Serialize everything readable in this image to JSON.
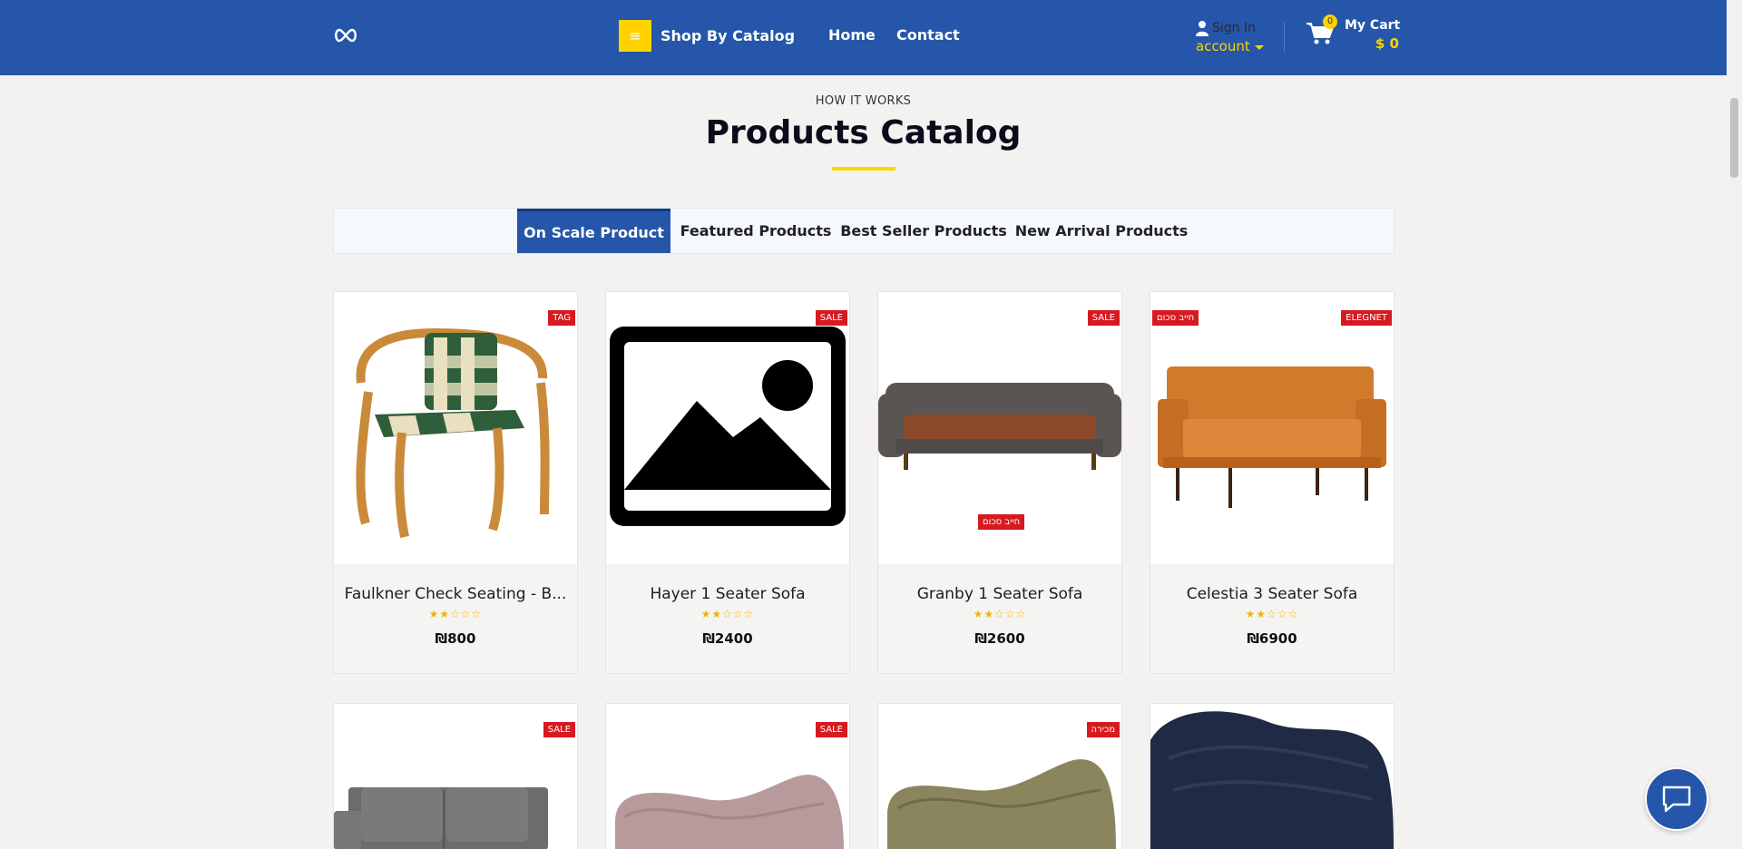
{
  "header": {
    "logo_icon": "infinity-logo-icon",
    "catalog_button_label": "Shop By Catalog",
    "nav": [
      {
        "label": "Home"
      },
      {
        "label": "Contact"
      }
    ],
    "signin": {
      "label": "Sign In",
      "account_label": "account"
    },
    "cart": {
      "label": "My Cart",
      "amount": "$ 0",
      "count": "0"
    }
  },
  "section": {
    "eyebrow": "HOW IT WORKS",
    "title": "Products Catalog"
  },
  "tabs": [
    {
      "label": "On Scale Product",
      "active": true
    },
    {
      "label": "Featured Products",
      "active": false
    },
    {
      "label": "Best Seller Products",
      "active": false
    },
    {
      "label": "New Arrival Products",
      "active": false
    }
  ],
  "products": [
    {
      "name": "Faulkner Check Seating - B...",
      "price": "₪800",
      "rating": 2,
      "badges": [
        "TAG"
      ],
      "image": "rattan-chair"
    },
    {
      "name": "Hayer 1 Seater Sofa",
      "price": "₪2400",
      "rating": 2,
      "badges": [
        "SALE"
      ],
      "image": "placeholder"
    },
    {
      "name": "Granby 1 Seater Sofa",
      "price": "₪2600",
      "rating": 2,
      "badges": [
        "SALE",
        "חייב סכום"
      ],
      "image": "chesterfield-sofa"
    },
    {
      "name": "Celestia 3 Seater Sofa",
      "price": "₪6900",
      "rating": 2,
      "badges": [
        "חייב סכום",
        "ELEGNET"
      ],
      "image": "orange-sofa"
    },
    {
      "badges": [
        "SALE"
      ],
      "image": "grey-sofa"
    },
    {
      "badges": [
        "SALE"
      ],
      "image": "pink-chaise"
    },
    {
      "badges": [
        "מכירה"
      ],
      "image": "olive-chaise"
    },
    {
      "badges": [],
      "image": "navy-armchair"
    }
  ],
  "stars": "★★☆☆☆",
  "colors": {
    "brand_blue": "#2556a9",
    "accent_yellow": "#ffd200",
    "badge_red": "#d71920"
  }
}
